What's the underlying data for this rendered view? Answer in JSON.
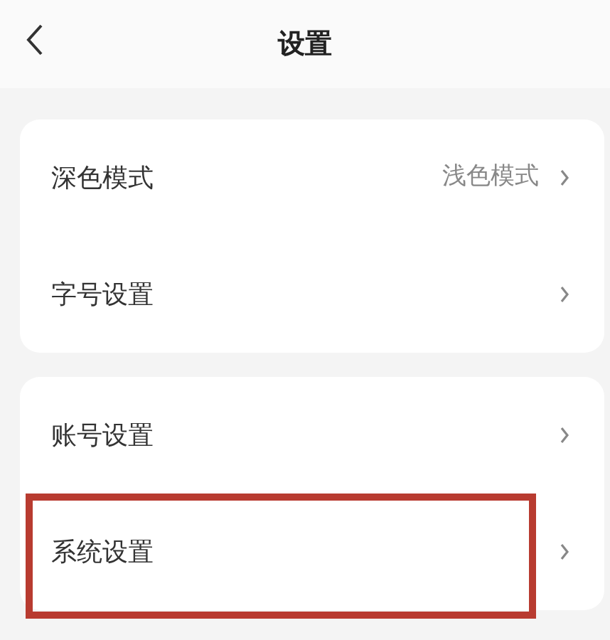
{
  "header": {
    "title": "设置"
  },
  "groups": [
    {
      "items": [
        {
          "label": "深色模式",
          "value": "浅色模式",
          "highlighted": false
        },
        {
          "label": "字号设置",
          "highlighted": false
        }
      ]
    },
    {
      "items": [
        {
          "label": "账号设置",
          "highlighted": false
        },
        {
          "label": "系统设置",
          "highlighted": true
        }
      ]
    }
  ]
}
